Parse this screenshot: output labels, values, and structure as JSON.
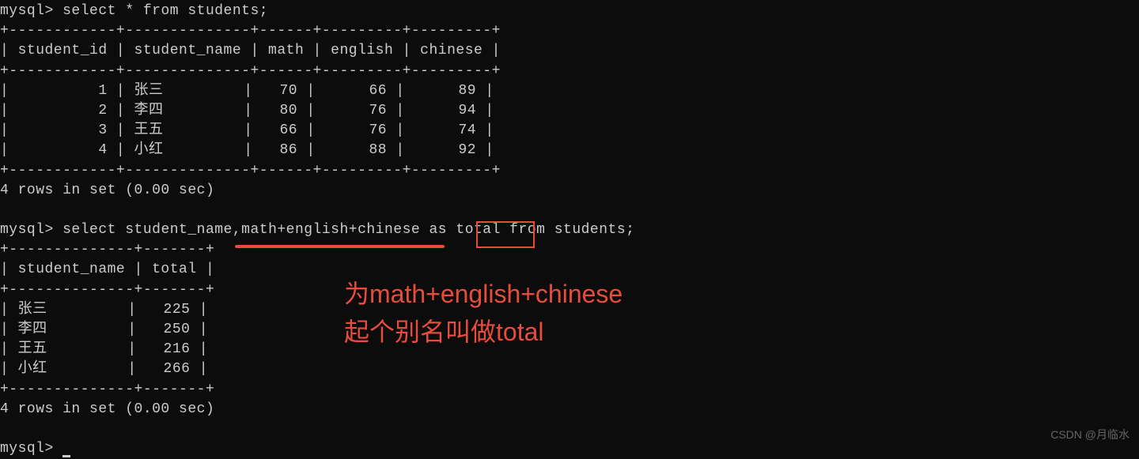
{
  "prompt": "mysql>",
  "query1": "select * from students;",
  "query2": "select student_name,math+english+chinese as total from students;",
  "query3_prompt": "mysql> ",
  "table1": {
    "border_top": "+------------+--------------+------+---------+---------+",
    "header": "| student_id | student_name | math | english | chinese |",
    "border_mid": "+------------+--------------+------+---------+---------+",
    "rows": [
      "|          1 | 张三         |   70 |      66 |      89 |",
      "|          2 | 李四         |   80 |      76 |      94 |",
      "|          3 | 王五         |   66 |      76 |      74 |",
      "|          4 | 小红         |   86 |      88 |      92 |"
    ],
    "border_bot": "+------------+--------------+------+---------+---------+",
    "summary": "4 rows in set (0.00 sec)"
  },
  "table2": {
    "border_top": "+--------------+-------+",
    "header": "| student_name | total |",
    "border_mid": "+--------------+-------+",
    "rows": [
      "| 张三         |   225 |",
      "| 李四         |   250 |",
      "| 王五         |   216 |",
      "| 小红         |   266 |"
    ],
    "border_bot": "+--------------+-------+",
    "summary": "4 rows in set (0.00 sec)"
  },
  "annotation": {
    "line1": "为math+english+chinese",
    "line2": "起个别名叫做total"
  },
  "watermark": "CSDN @月临水"
}
